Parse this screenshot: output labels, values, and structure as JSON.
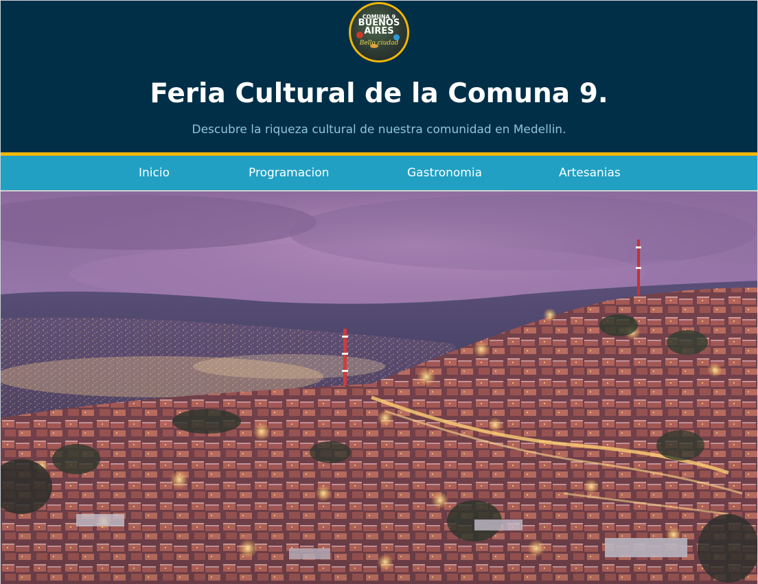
{
  "header": {
    "logo": {
      "line1": "COMUNA 9",
      "line2": "BUENOS",
      "line3": "AIRES",
      "tagline": "Bello ciudad"
    },
    "title": "Feria Cultural de la Comuna 9.",
    "subtitle": "Descubre la riqueza cultural de nuestra comunidad en Medellin."
  },
  "nav": {
    "items": [
      {
        "label": "Inicio"
      },
      {
        "label": "Programacion"
      },
      {
        "label": "Gastronomia"
      },
      {
        "label": "Artesanias"
      }
    ]
  },
  "hero": {
    "subject": "Night view of Medellin hillside neighborhood with city lights and purple sky"
  },
  "colors": {
    "header_bg": "#012f47",
    "accent_gold": "#f2b705",
    "nav_bg": "#21a0c3",
    "subtitle": "#8ec5dd"
  }
}
